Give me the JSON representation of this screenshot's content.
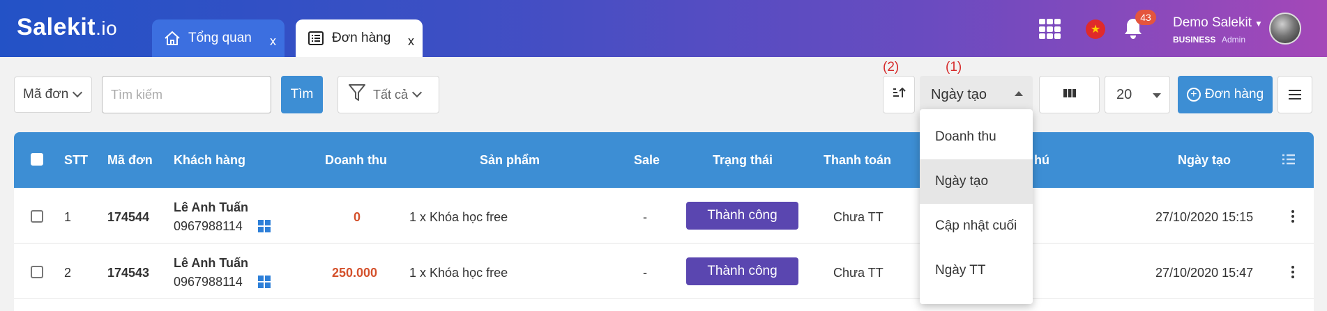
{
  "brand": {
    "logo_main": "Salekit",
    "logo_dot": ".io"
  },
  "tabs": [
    {
      "label": "Tổng quan",
      "close": "x",
      "icon": "home-icon"
    },
    {
      "label": "Đơn hàng",
      "close": "x",
      "icon": "list-icon"
    }
  ],
  "header": {
    "notification_count": "43",
    "user_name": "Demo Salekit",
    "plan": "BUSINESS",
    "role": "Admin",
    "flag_symbol": "★"
  },
  "toolbar": {
    "field_select": "Mã đơn",
    "search_placeholder": "Tìm kiếm",
    "search_value": "",
    "find_label": "Tìm",
    "filter_label": "Tất cả",
    "annotation_sort_dir": "(2)",
    "annotation_sort_field": "(1)",
    "sort_field": "Ngày tạo",
    "page_size": "20",
    "add_label": "Đơn hàng"
  },
  "sort_options": [
    {
      "label": "Doanh thu",
      "selected": false
    },
    {
      "label": "Ngày tạo",
      "selected": true
    },
    {
      "label": "Cập nhật cuối",
      "selected": false
    },
    {
      "label": "Ngày TT",
      "selected": false
    }
  ],
  "table": {
    "columns": [
      "STT",
      "Mã đơn",
      "Khách hàng",
      "Doanh thu",
      "Sản phẩm",
      "Sale",
      "Trạng thái",
      "Thanh toán",
      "hú",
      "Ngày tạo"
    ],
    "rows": [
      {
        "stt": "1",
        "order_id": "174544",
        "customer_name": "Lê Anh Tuấn",
        "phone": "0967988114",
        "revenue": "0",
        "product": "1 x Khóa học free",
        "sale": "-",
        "status": "Thành công",
        "payment": "Chưa TT",
        "created": "27/10/2020 15:15"
      },
      {
        "stt": "2",
        "order_id": "174543",
        "customer_name": "Lê Anh Tuấn",
        "phone": "0967988114",
        "revenue": "250.000",
        "product": "1 x Khóa học free",
        "sale": "-",
        "status": "Thành công",
        "payment": "Chưa TT",
        "created": "27/10/2020 15:47"
      }
    ]
  },
  "colors": {
    "header_start": "#2352c6",
    "header_end": "#a448b8",
    "accent": "#3d8ed4",
    "status": "#5a46b0",
    "revenue": "#d4512c",
    "badge": "#e4553d",
    "annotation": "#d62a2a"
  }
}
